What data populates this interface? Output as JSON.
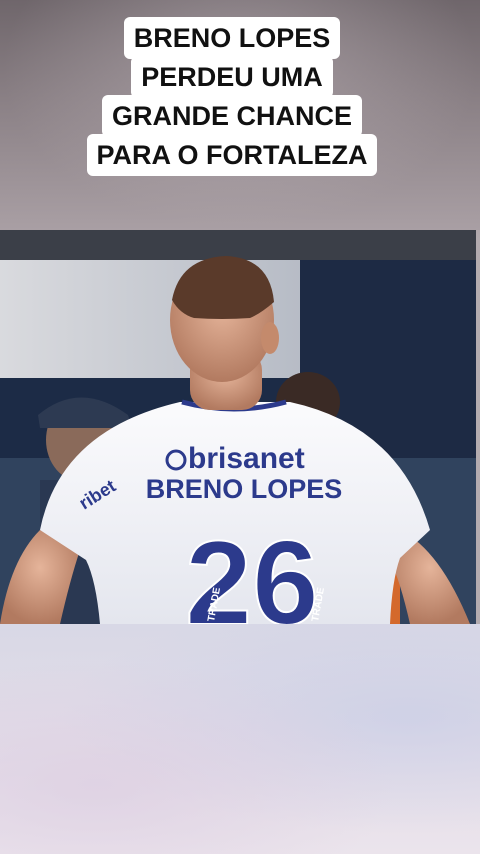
{
  "caption": {
    "lines": [
      "BRENO LOPES",
      "PERDEU UMA",
      "GRANDE CHANCE",
      "PARA O FORTALEZA"
    ]
  },
  "jersey": {
    "sponsor": "brisanet",
    "name": "BRENO LOPES",
    "number": "26",
    "sleeve_sponsor": "ribet",
    "side_text": "TRADE"
  },
  "colors": {
    "jersey_white": "#f4f4f6",
    "jersey_blue": "#2c3a8c",
    "caption_bg": "#ffffff",
    "caption_text": "#111111"
  }
}
